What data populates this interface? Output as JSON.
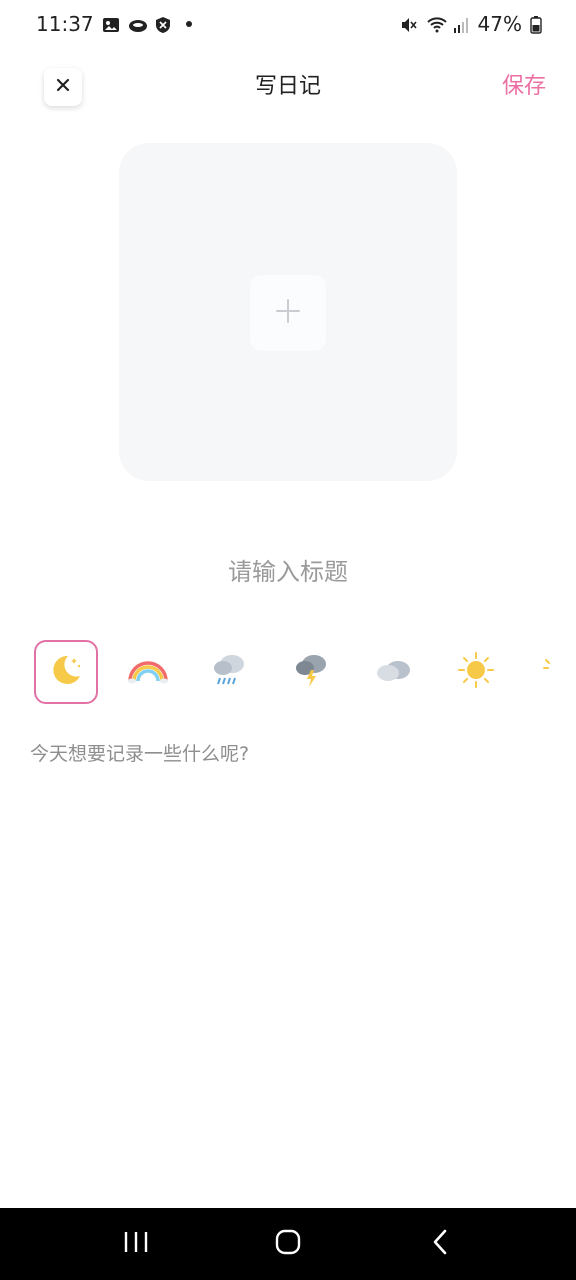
{
  "status_bar": {
    "time": "11:37",
    "battery": "47%",
    "icons": [
      "gallery-icon",
      "cloud-icon",
      "shield-icon",
      "mute-icon",
      "wifi-icon",
      "signal-icon",
      "battery-icon"
    ]
  },
  "header": {
    "title": "写日记",
    "save_label": "保存",
    "close_icon": "close-icon"
  },
  "photo": {
    "add_icon": "plus-icon"
  },
  "title_field": {
    "value": "",
    "placeholder": "请输入标题"
  },
  "weather": {
    "selected": "moon",
    "options": [
      "moon",
      "rainbow",
      "rain",
      "thunderstorm",
      "cloudy",
      "sunny",
      "partly-sunny"
    ]
  },
  "content_field": {
    "value": "",
    "placeholder": "今天想要记录一些什么呢?"
  },
  "colors": {
    "accent": "#ec6fa4",
    "photo_bg": "#f5f7f9"
  }
}
